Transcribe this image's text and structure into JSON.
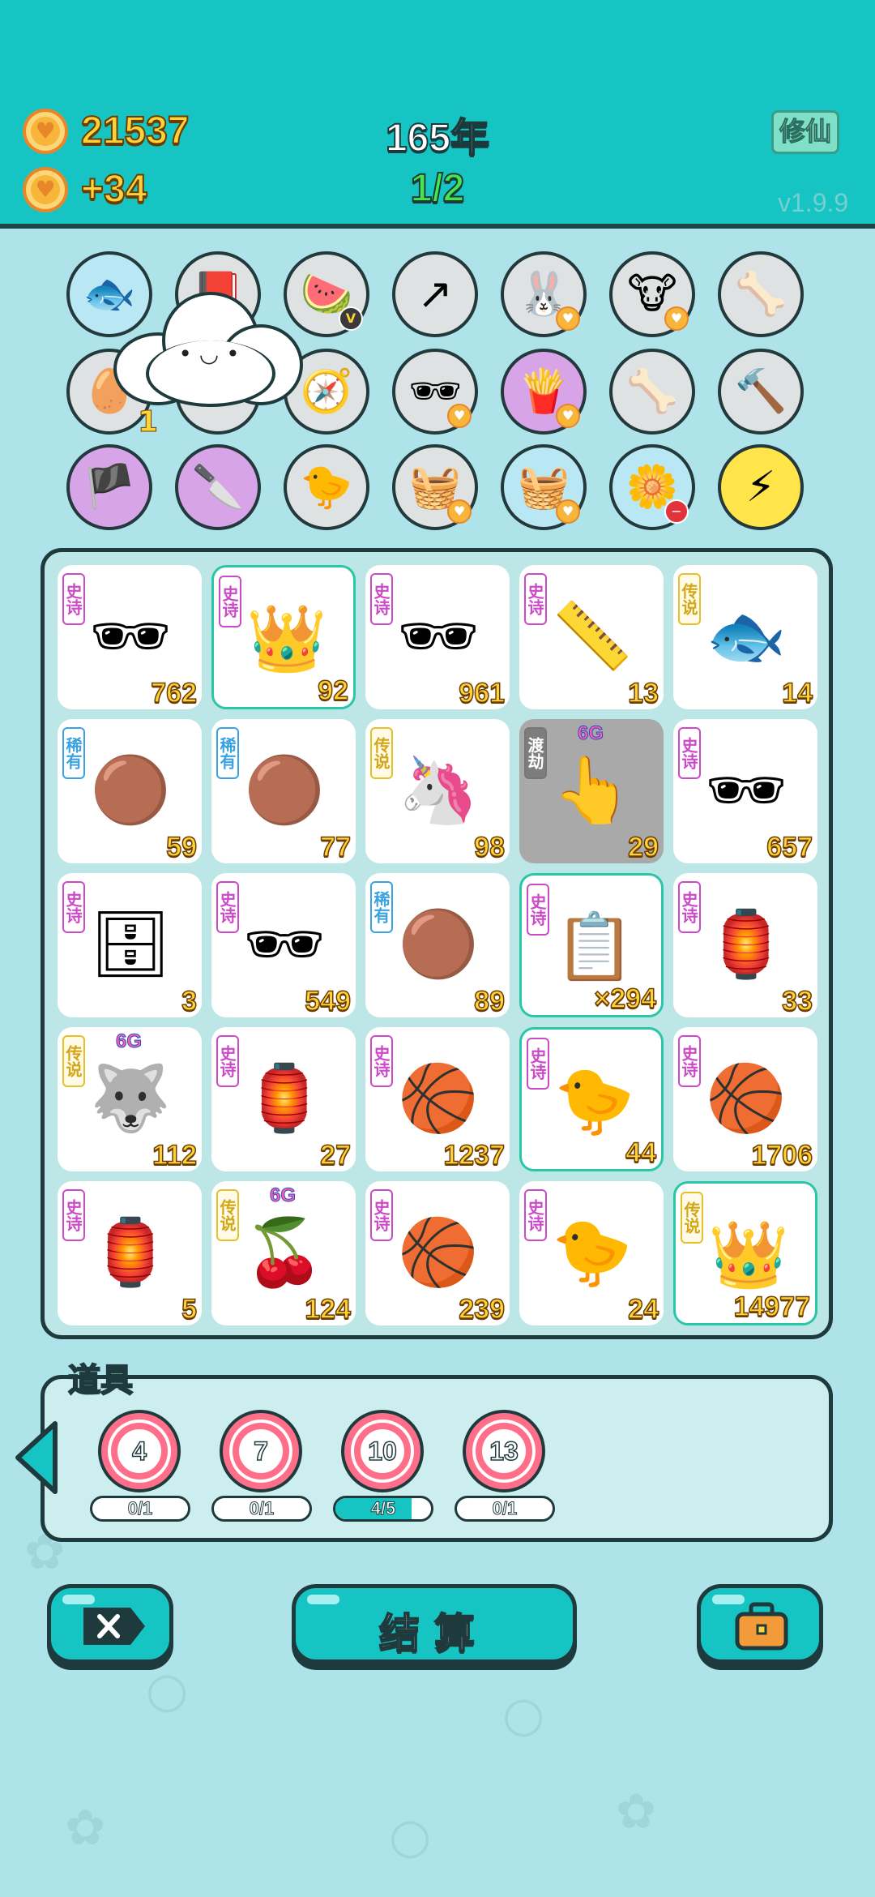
{
  "header": {
    "coins": "21537",
    "income": "+34",
    "year": "165年",
    "round": "1/2",
    "cultivate_button": "修仙",
    "version": "v1.9.9"
  },
  "relics": [
    {
      "name": "fish-tank",
      "glyph": "🐟",
      "bg": "blue"
    },
    {
      "name": "time-magazine",
      "glyph": "📕",
      "bg": "gray"
    },
    {
      "name": "fruit-basket",
      "glyph": "🍉",
      "bg": "gray",
      "badge": "V"
    },
    {
      "name": "arrow-box",
      "glyph": "↗",
      "bg": "gray"
    },
    {
      "name": "rabbit",
      "glyph": "🐰",
      "bg": "gray",
      "badge": "♥"
    },
    {
      "name": "twin-cows",
      "glyph": "🐮",
      "bg": "gray",
      "badge": "♥"
    },
    {
      "name": "pet-bowl",
      "glyph": "🦴",
      "bg": "gray"
    },
    {
      "name": "egg-tray",
      "glyph": "🥚",
      "bg": "gray"
    },
    {
      "name": "hidden-item",
      "glyph": "",
      "bg": "gray"
    },
    {
      "name": "compass",
      "glyph": "🧭",
      "bg": "gray"
    },
    {
      "name": "sunglasses-pair",
      "glyph": "🕶",
      "bg": "gray",
      "badge": "♥"
    },
    {
      "name": "lightning-fries",
      "glyph": "🍟",
      "bg": "purple",
      "badge": "♥"
    },
    {
      "name": "pet-bowl-2",
      "glyph": "🦴",
      "bg": "gray"
    },
    {
      "name": "hammer",
      "glyph": "🔨",
      "bg": "gray"
    },
    {
      "name": "eyepatch",
      "glyph": "🏴",
      "bg": "purple"
    },
    {
      "name": "cleaver",
      "glyph": "🔪",
      "bg": "purple"
    },
    {
      "name": "chick-egg",
      "glyph": "🐤",
      "bg": "gray"
    },
    {
      "name": "fruit-basket-2",
      "glyph": "🧺",
      "bg": "gray",
      "badge": "♥"
    },
    {
      "name": "fruit-basket-3",
      "glyph": "🧺",
      "bg": "blue",
      "badge": "♥"
    },
    {
      "name": "potted-star",
      "glyph": "🌼",
      "bg": "blue",
      "badge": "−"
    },
    {
      "name": "lightning-bolt",
      "glyph": "⚡",
      "bg": "yellow"
    }
  ],
  "relic_count": "1",
  "board": {
    "cards": [
      {
        "rarity": "史诗",
        "r": "epic",
        "glyph": "🕶",
        "name": "green-hat-man",
        "num": "762"
      },
      {
        "rarity": "史诗",
        "r": "epic",
        "glyph": "👑",
        "name": "king-elder",
        "num": "92",
        "sel": true
      },
      {
        "rarity": "史诗",
        "r": "epic",
        "glyph": "🕶",
        "name": "green-hat-man",
        "num": "961"
      },
      {
        "rarity": "史诗",
        "r": "epic",
        "glyph": "📏",
        "name": "ruler",
        "num": "13"
      },
      {
        "rarity": "传说",
        "r": "legend",
        "glyph": "🐟",
        "name": "koi-fish",
        "num": "14"
      },
      {
        "rarity": "稀有",
        "r": "rare",
        "glyph": "🟤",
        "name": "small-ball",
        "num": "59"
      },
      {
        "rarity": "稀有",
        "r": "rare",
        "glyph": "🟤",
        "name": "small-ball",
        "num": "77"
      },
      {
        "rarity": "传说",
        "r": "legend",
        "glyph": "🦄",
        "name": "unicorn",
        "num": "98"
      },
      {
        "rarity": "渡劫",
        "r": "dujie",
        "glyph": "👆",
        "name": "pointing-hand",
        "num": "29",
        "tag": "6G",
        "gray": true
      },
      {
        "rarity": "史诗",
        "r": "epic",
        "glyph": "🕶",
        "name": "green-hat-man",
        "num": "657"
      },
      {
        "rarity": "史诗",
        "r": "epic",
        "glyph": "🗄",
        "name": "server-rack",
        "num": "3"
      },
      {
        "rarity": "史诗",
        "r": "epic",
        "glyph": "🕶",
        "name": "green-hat-man",
        "num": "549"
      },
      {
        "rarity": "稀有",
        "r": "rare",
        "glyph": "🟤",
        "name": "small-ball",
        "num": "89"
      },
      {
        "rarity": "史诗",
        "r": "epic",
        "glyph": "📋",
        "name": "ctrl-c-cards",
        "num": "×294",
        "sel": true
      },
      {
        "rarity": "史诗",
        "r": "epic",
        "glyph": "🏮",
        "name": "rabbit-tent",
        "num": "33"
      },
      {
        "rarity": "传说",
        "r": "legend",
        "glyph": "🐺",
        "name": "husky-king",
        "num": "112",
        "tag": "6G"
      },
      {
        "rarity": "史诗",
        "r": "epic",
        "glyph": "🏮",
        "name": "rabbit-tent",
        "num": "27"
      },
      {
        "rarity": "史诗",
        "r": "epic",
        "glyph": "🏀",
        "name": "green-hat-ball",
        "num": "1237"
      },
      {
        "rarity": "史诗",
        "r": "epic",
        "glyph": "🐤",
        "name": "gray-hair-chick",
        "num": "44",
        "sel": true
      },
      {
        "rarity": "史诗",
        "r": "epic",
        "glyph": "🏀",
        "name": "green-hat-ball",
        "num": "1706"
      },
      {
        "rarity": "史诗",
        "r": "epic",
        "glyph": "🏮",
        "name": "rabbit-tent",
        "num": "5"
      },
      {
        "rarity": "传说",
        "r": "legend",
        "glyph": "🍒",
        "name": "twin-fruit",
        "num": "124",
        "tag": "6G"
      },
      {
        "rarity": "史诗",
        "r": "epic",
        "glyph": "🏀",
        "name": "green-hat-ball",
        "num": "239"
      },
      {
        "rarity": "史诗",
        "r": "epic",
        "glyph": "🐤",
        "name": "gray-hair-chick",
        "num": "24"
      },
      {
        "rarity": "传说",
        "r": "legend",
        "glyph": "👑",
        "name": "king-grin",
        "num": "14977",
        "sel": true
      }
    ]
  },
  "props": {
    "title": "道具",
    "items": [
      {
        "value": "4",
        "progress": "0/1",
        "fraction": 0
      },
      {
        "value": "7",
        "progress": "0/1",
        "fraction": 0
      },
      {
        "value": "10",
        "progress": "4/5",
        "fraction": 0.8
      },
      {
        "value": "13",
        "progress": "0/1",
        "fraction": 0
      }
    ]
  },
  "buttons": {
    "settle": "结算"
  },
  "colors": {
    "header": "#17c4c4",
    "background": "#aee3ea",
    "accent_gold": "#ffd23a",
    "round_green": "#45e64a"
  }
}
